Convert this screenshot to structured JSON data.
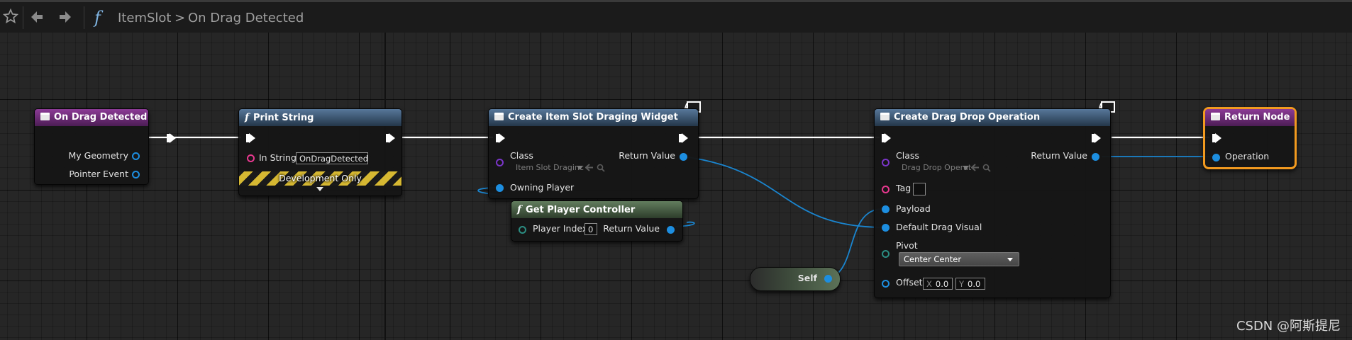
{
  "toolbar": {
    "breadcrumb_graph": "ItemSlot",
    "breadcrumb_sep": ">",
    "breadcrumb_func": "On Drag Detected",
    "func_glyph": "f"
  },
  "nodes": {
    "on_drag_detected": {
      "title": "On Drag Detected",
      "pins": [
        "My Geometry",
        "Pointer Event"
      ]
    },
    "print_string": {
      "title": "Print String",
      "in_string_label": "In String",
      "in_string_value": "OnDragDetected",
      "dev_label": "Development Only"
    },
    "create_widget": {
      "title": "Create Item Slot Draging Widget",
      "class_label": "Class",
      "class_value": "Item Slot Draginc",
      "return_label": "Return Value",
      "owning_label": "Owning Player"
    },
    "get_player_controller": {
      "title": "Get Player Controller",
      "index_label": "Player Index",
      "index_value": "0",
      "return_label": "Return Value"
    },
    "create_drag_drop": {
      "title": "Create Drag Drop Operation",
      "class_label": "Class",
      "class_value": "Drag Drop Operat",
      "return_label": "Return Value",
      "tag_label": "Tag",
      "payload_label": "Payload",
      "visual_label": "Default Drag Visual",
      "pivot_label": "Pivot",
      "pivot_value": "Center Center",
      "offset_label": "Offset",
      "offset_x_label": "X",
      "offset_x": "0.0",
      "offset_y_label": "Y",
      "offset_y": "0.0"
    },
    "self": {
      "label": "Self"
    },
    "return_node": {
      "title": "Return Node",
      "operation_label": "Operation"
    }
  },
  "watermark": "CSDN @阿斯提尼",
  "colors": {
    "event_header": "#8c3b96",
    "function_header": "#57779a",
    "pure_header": "#627d5e",
    "object_pin": "#1d8ee0",
    "string_pin": "#e8388f",
    "class_pin": "#7a35c8",
    "return_highlight": "#f29a1f"
  }
}
